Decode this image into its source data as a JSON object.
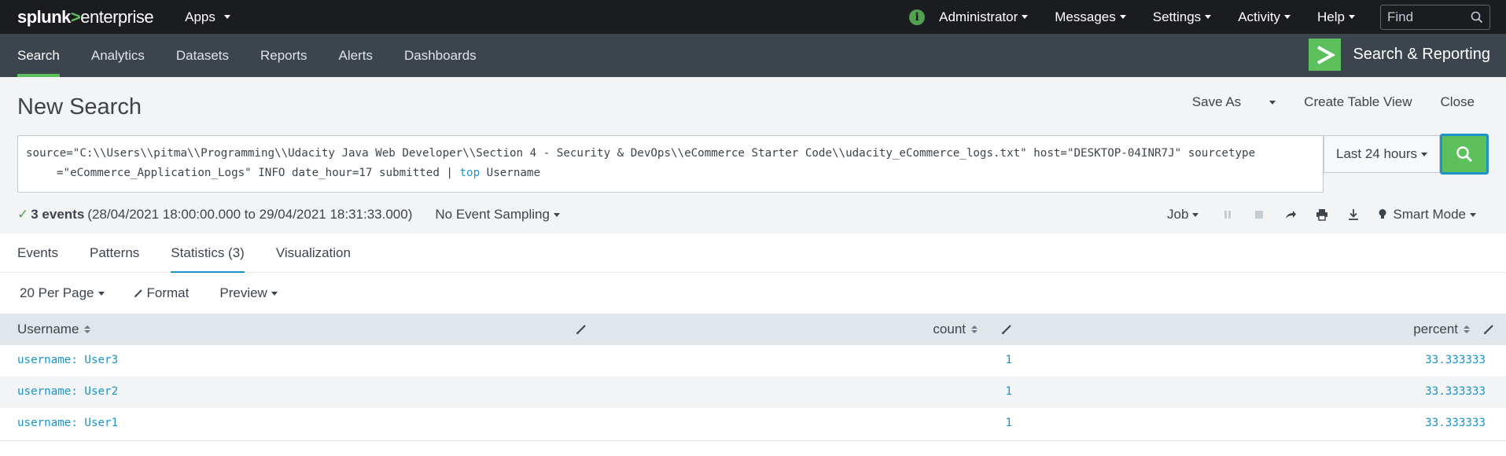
{
  "topbar": {
    "logo_part1": "splunk",
    "logo_part2": ">",
    "logo_part3": "enterprise",
    "apps_label": "Apps",
    "info_icon": "info-icon",
    "admin_label": "Administrator",
    "messages_label": "Messages",
    "settings_label": "Settings",
    "activity_label": "Activity",
    "help_label": "Help",
    "find_placeholder": "Find"
  },
  "appbar": {
    "tabs": [
      {
        "label": "Search"
      },
      {
        "label": "Analytics"
      },
      {
        "label": "Datasets"
      },
      {
        "label": "Reports"
      },
      {
        "label": "Alerts"
      },
      {
        "label": "Dashboards"
      }
    ],
    "app_title": "Search & Reporting"
  },
  "header": {
    "title": "New Search",
    "save_as": "Save As",
    "create_table_view": "Create Table View",
    "close": "Close",
    "query_line1": "source=\"C:\\\\Users\\\\pitma\\\\Programming\\\\Udacity Java Web Developer\\\\Section 4 - Security & DevOps\\\\eCommerce Starter Code\\\\udacity_eCommerce_logs.txt\" host=\"DESKTOP-04INR7J\" sourcetype",
    "query_line2_pre": "=\"eCommerce_Application_Logs\" INFO date_hour=17 submitted | ",
    "query_line2_kw": "top",
    "query_line2_post": " Username",
    "time_range": "Last 24 hours",
    "status_check": "✓",
    "status_events": "3 events",
    "status_range": "(28/04/2021 18:00:00.000 to 29/04/2021 18:31:33.000)",
    "sampling": "No Event Sampling",
    "job": "Job",
    "mode": "Smart Mode"
  },
  "result_tabs": [
    {
      "label": "Events"
    },
    {
      "label": "Patterns"
    },
    {
      "label": "Statistics (3)"
    },
    {
      "label": "Visualization"
    }
  ],
  "table_toolbar": {
    "per_page": "20 Per Page",
    "format": "Format",
    "preview": "Preview"
  },
  "table": {
    "columns": [
      "Username",
      "count",
      "percent"
    ],
    "rows": [
      {
        "username": "username: User3",
        "count": "1",
        "percent": "33.333333"
      },
      {
        "username": "username: User2",
        "count": "1",
        "percent": "33.333333"
      },
      {
        "username": "username: User1",
        "count": "1",
        "percent": "33.333333"
      }
    ]
  },
  "colors": {
    "brand_green": "#5cc05c",
    "link_blue": "#1e93c6",
    "topbar_bg": "#1a1c20",
    "appbar_bg": "#3c444d"
  }
}
